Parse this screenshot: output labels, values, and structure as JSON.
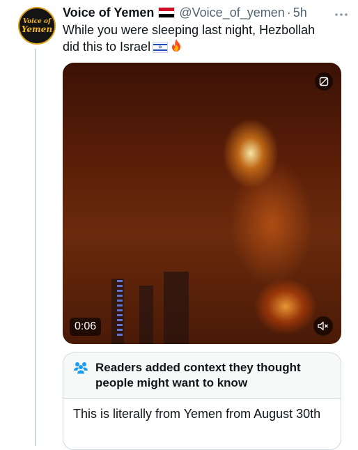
{
  "tweet": {
    "avatar_text_line1": "Voice of",
    "avatar_text_line2": "Yemen",
    "display_name": "Voice of Yemen",
    "handle": "@Voice_of_yemen",
    "separator": "·",
    "timestamp": "5h",
    "more_icon": "more-horizontal-icon",
    "text_line1": "While you were sleeping last night, Hezbollah",
    "text_line2": "did this to Israel",
    "emojis": [
      "israel-flag-icon",
      "fire-icon"
    ],
    "author_flag": "yemen-flag-icon"
  },
  "media": {
    "type": "video",
    "duration": "0:06",
    "controls": [
      "gif-toggle-icon",
      "mute-icon"
    ]
  },
  "community_note": {
    "icon": "people-icon",
    "title": "Readers added context they thought people might want to know",
    "body": "This is literally from Yemen from August 30th"
  },
  "colors": {
    "text_primary": "#0f1419",
    "text_secondary": "#536471",
    "border": "#cfd9de",
    "note_header_bg": "#f7f9f9",
    "note_icon": "#1d9bf0"
  }
}
